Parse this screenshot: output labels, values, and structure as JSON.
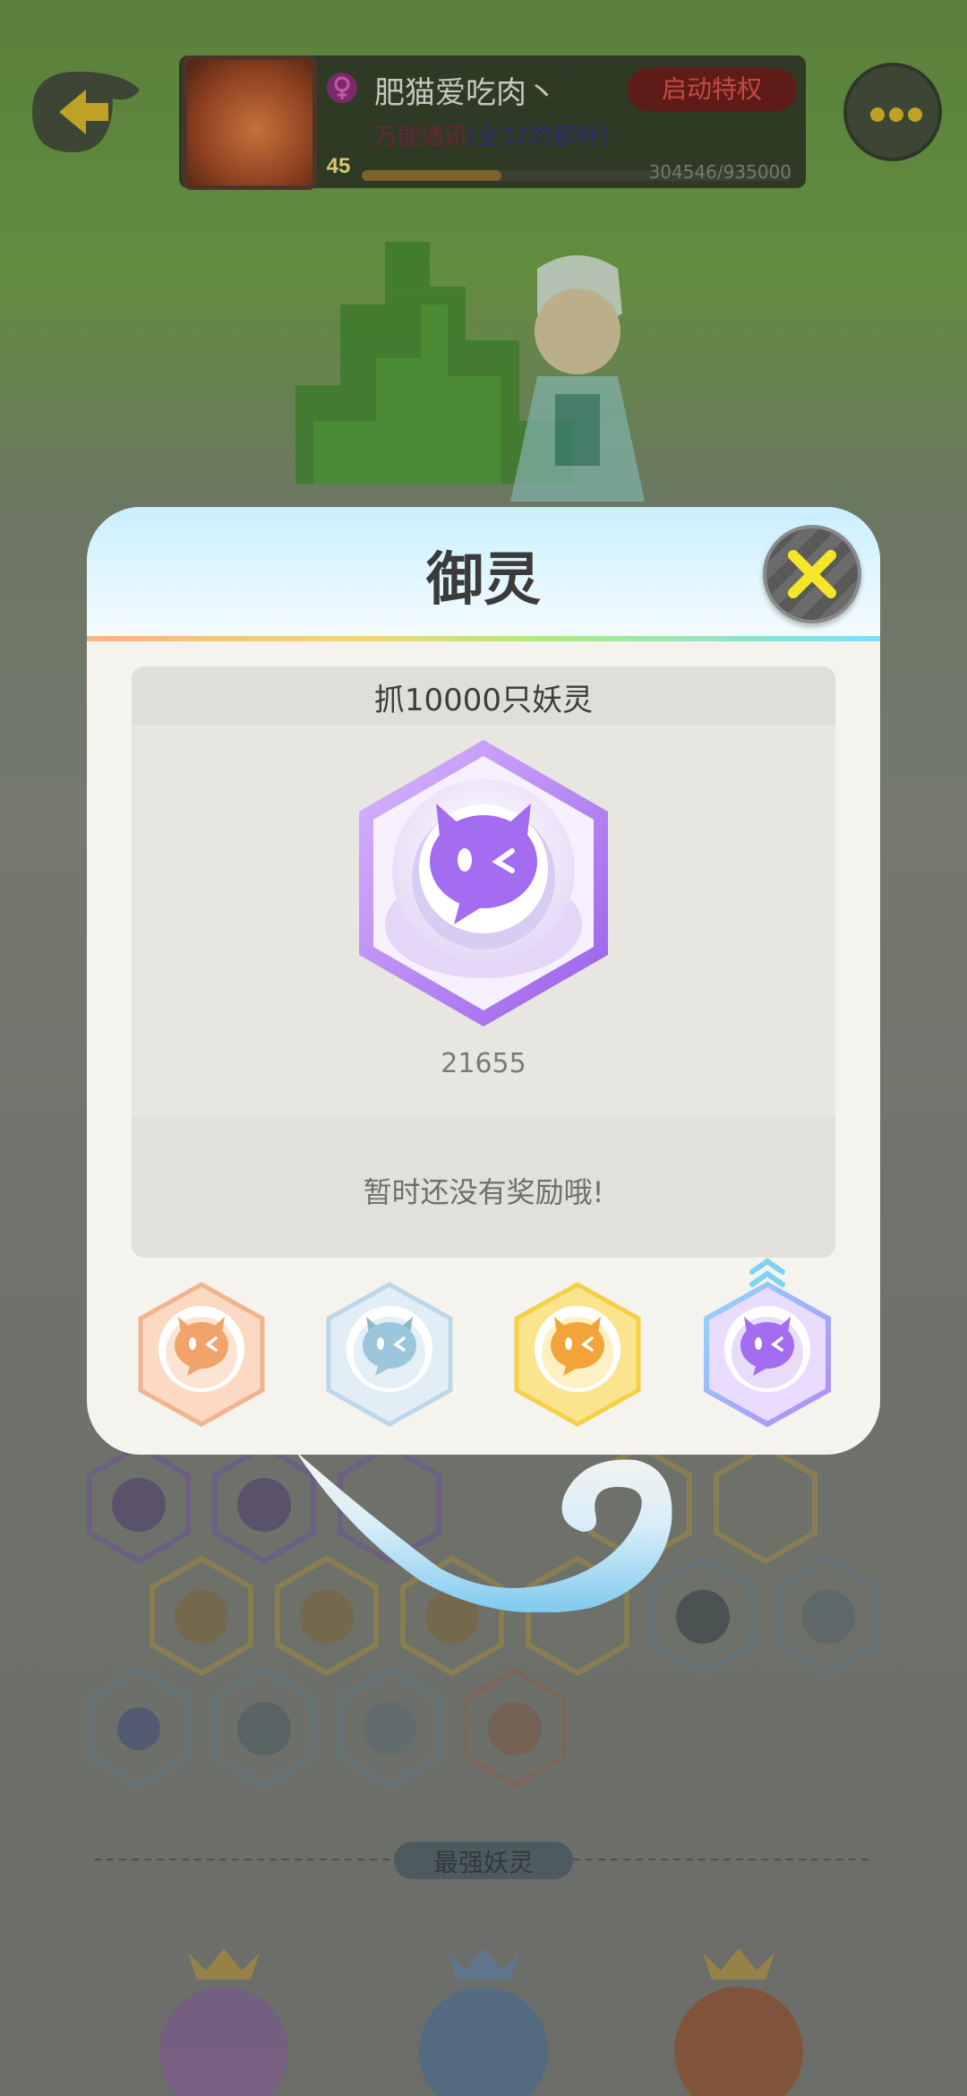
{
  "profile": {
    "nickname": "肥猫爱吃肉丶",
    "level": "45",
    "privilege_button": "启动特权",
    "subtitle_red": "万能通讯",
    "subtitle_blue": "[全32的那种]",
    "xp_text": "304546/935000",
    "xp_progress": 0.325
  },
  "modal": {
    "title": "御灵",
    "task": "抓10000只妖灵",
    "count": "21655",
    "reward_text": "暂时还没有奖励哦!",
    "tiers": [
      "bronze",
      "silver",
      "gold",
      "purple"
    ],
    "selected_tier": "purple"
  },
  "background": {
    "section_label": "最强妖灵"
  },
  "colors": {
    "accent_purple": "#a46cf0",
    "badge_bronze": "#f2a36c",
    "badge_silver": "#9cc6dc",
    "badge_gold": "#f5c94a",
    "close_x": "#f6e629"
  }
}
